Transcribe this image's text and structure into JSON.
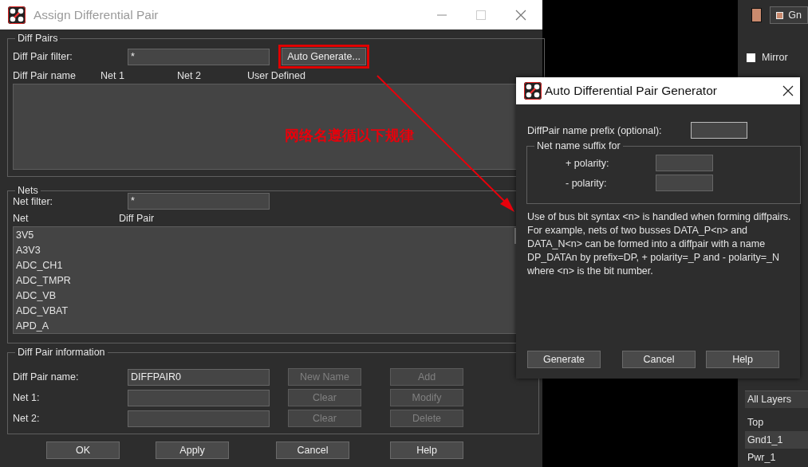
{
  "main_dialog": {
    "title": "Assign Differential Pair",
    "diff_pairs": {
      "title": "Diff Pairs",
      "filter_label": "Diff Pair filter:",
      "filter_value": "*",
      "auto_generate_button": "Auto Generate...",
      "highlighted": true,
      "columns": [
        "Diff Pair name",
        "Net 1",
        "Net 2",
        "User Defined"
      ]
    },
    "nets": {
      "title": "Nets",
      "filter_label": "Net filter:",
      "filter_value": "*",
      "columns": [
        "Net",
        "Diff Pair"
      ],
      "items": [
        "3V5",
        "A3V3",
        "ADC_CH1",
        "ADC_TMPR",
        "ADC_VB",
        "ADC_VBAT",
        "APD_A"
      ]
    },
    "info": {
      "title": "Diff Pair information",
      "rows": [
        {
          "label": "Diff Pair name:",
          "value": "DIFFPAIR0",
          "buttons": [
            {
              "label": "New Name",
              "disabled": true
            },
            {
              "label": "Add",
              "disabled": true
            }
          ]
        },
        {
          "label": "Net 1:",
          "buttons": [
            {
              "label": "Clear",
              "disabled": true
            },
            {
              "label": "Modify",
              "disabled": true
            }
          ]
        },
        {
          "label": "Net 2:",
          "buttons": [
            {
              "label": "Clear",
              "disabled": true
            },
            {
              "label": "Delete",
              "disabled": true
            }
          ]
        }
      ]
    },
    "buttons": [
      "OK",
      "Apply",
      "Cancel",
      "Help"
    ]
  },
  "annotation": {
    "text": "网络名遵循以下规律"
  },
  "generator_dialog": {
    "title": "Auto Differential Pair Generator",
    "prefix_label": "DiffPair name prefix (optional):",
    "suffix_group": "Net name suffix for",
    "plus_label": "+ polarity:",
    "minus_label": "- polarity:",
    "description": "Use of bus bit syntax <n> is handled when forming diffpairs. For example, nets of two busses DATA_P<n> and DATA_N<n> can be formed into a diffpair with a name DP_DATAn by prefix=DP, + polarity=_P and - polarity=_N where <n> is the bit number.",
    "buttons": [
      "Generate",
      "Cancel",
      "Help"
    ]
  },
  "side_panel": {
    "layer_button": "Gn",
    "mirror": {
      "label": "Mirror",
      "checked": false
    },
    "layer_filter": "All Layers",
    "layers": [
      {
        "label": "Top",
        "selected": false
      },
      {
        "label": "Gnd1_1",
        "selected": true
      },
      {
        "label": "Pwr_1",
        "selected": false
      }
    ]
  }
}
